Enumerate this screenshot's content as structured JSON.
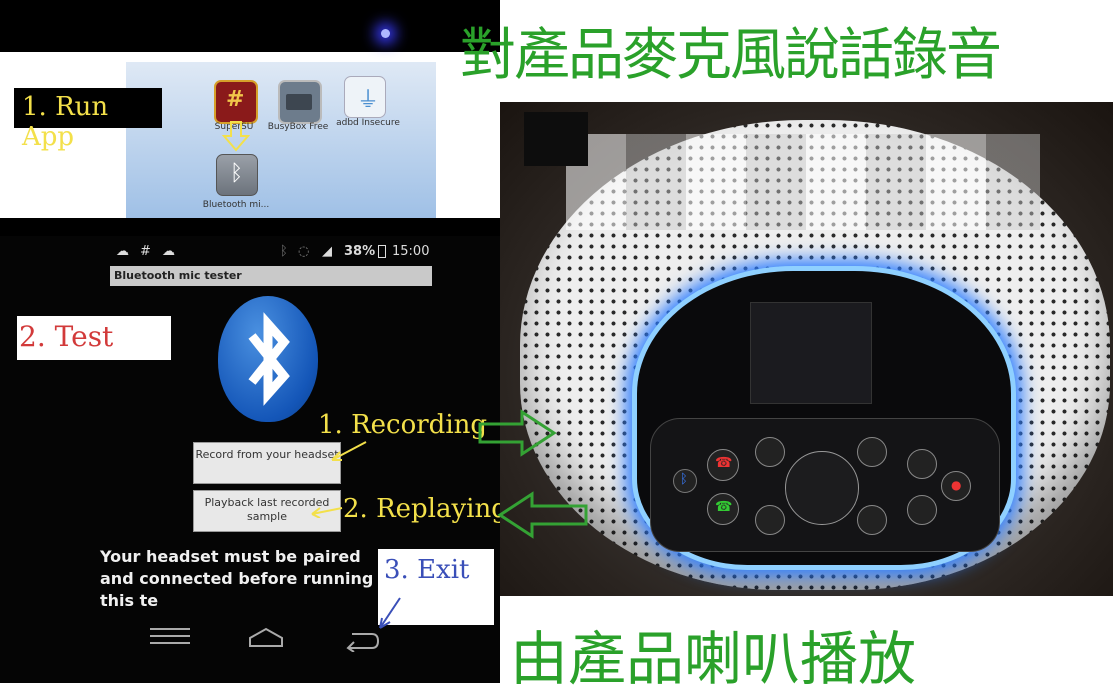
{
  "top_heading": "對產品麥克風說話錄音",
  "bottom_heading": "由產品喇叭播放",
  "launcher": {
    "step_label": "1. Run App",
    "apps": [
      {
        "label": "SuperSU",
        "icon": "supersu-icon"
      },
      {
        "label": "BusyBox Free",
        "icon": "busybox-icon"
      },
      {
        "label": "adbd Insecure",
        "icon": "usb-icon"
      },
      {
        "label": "Bluetooth mi...",
        "icon": "bluetooth-app-icon"
      }
    ],
    "partial_label": "run"
  },
  "phone": {
    "status": {
      "battery": "38%",
      "time": "15:00"
    },
    "app_title": "Bluetooth mic tester",
    "step_label": "2. Test",
    "record_button": "Record from your headset",
    "playback_button": "Playback last recorded sample",
    "warning": "Your headset must be paired and connected before running this te",
    "nav": [
      "menu-icon",
      "home-icon",
      "back-icon"
    ]
  },
  "annotations": {
    "recording": "1. Recording",
    "replaying": "2. Replaying",
    "exit": "3. Exit"
  },
  "colors": {
    "heading_green": "#2aa12a",
    "annotation_yellow": "#f3e04a",
    "step_red": "#d23a3a",
    "exit_blue": "#3a4fb8",
    "arrow_green": "#34a234"
  }
}
